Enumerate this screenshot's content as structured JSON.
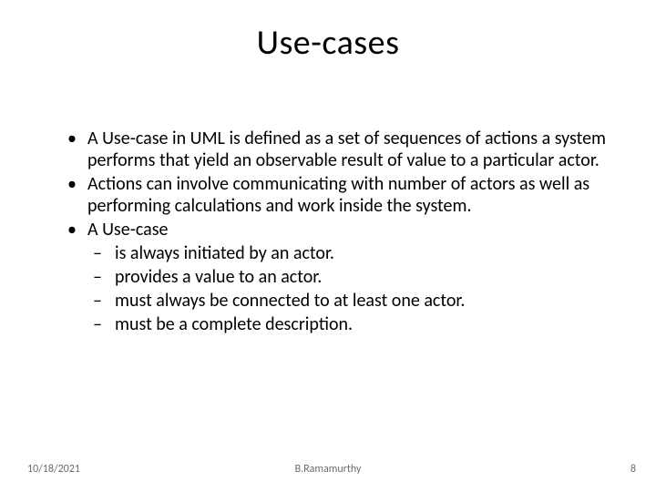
{
  "title": "Use-cases",
  "bullets": [
    {
      "text": "A Use-case in UML is defined as a set of sequences of actions a system performs that yield an observable result of value to a particular actor."
    },
    {
      "text": "Actions can involve communicating with number of actors as well as performing calculations and work inside the system."
    },
    {
      "text": "A Use-case",
      "sub": [
        "is always initiated by an actor.",
        "provides a value to an actor.",
        "must always be connected to at least one actor.",
        "must be a complete description."
      ]
    }
  ],
  "footer": {
    "date": "10/18/2021",
    "author": "B.Ramamurthy",
    "page": "8"
  }
}
